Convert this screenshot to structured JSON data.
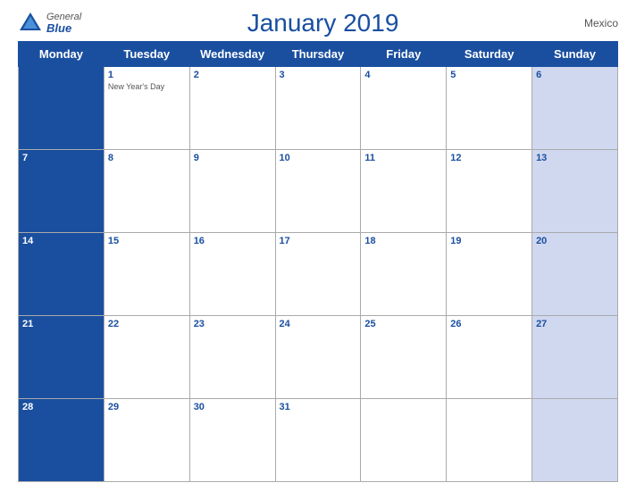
{
  "logo": {
    "general": "General",
    "blue": "Blue",
    "icon_shape": "triangle"
  },
  "header": {
    "title": "January 2019",
    "country": "Mexico"
  },
  "days_of_week": [
    "Monday",
    "Tuesday",
    "Wednesday",
    "Thursday",
    "Friday",
    "Saturday",
    "Sunday"
  ],
  "weeks": [
    [
      {
        "day": "",
        "empty": true
      },
      {
        "day": "1",
        "holiday": "New Year's Day"
      },
      {
        "day": "2"
      },
      {
        "day": "3"
      },
      {
        "day": "4"
      },
      {
        "day": "5"
      },
      {
        "day": "6"
      }
    ],
    [
      {
        "day": "7"
      },
      {
        "day": "8"
      },
      {
        "day": "9"
      },
      {
        "day": "10"
      },
      {
        "day": "11"
      },
      {
        "day": "12"
      },
      {
        "day": "13"
      }
    ],
    [
      {
        "day": "14"
      },
      {
        "day": "15"
      },
      {
        "day": "16"
      },
      {
        "day": "17"
      },
      {
        "day": "18"
      },
      {
        "day": "19"
      },
      {
        "day": "20"
      }
    ],
    [
      {
        "day": "21"
      },
      {
        "day": "22"
      },
      {
        "day": "23"
      },
      {
        "day": "24"
      },
      {
        "day": "25"
      },
      {
        "day": "26"
      },
      {
        "day": "27"
      }
    ],
    [
      {
        "day": "28"
      },
      {
        "day": "29"
      },
      {
        "day": "30"
      },
      {
        "day": "31"
      },
      {
        "day": ""
      },
      {
        "day": ""
      },
      {
        "day": ""
      }
    ]
  ],
  "colors": {
    "header_bg": "#1a4fa0",
    "sunday_bg": "#d0d8f0",
    "monday_bg": "#1a4fa0"
  }
}
